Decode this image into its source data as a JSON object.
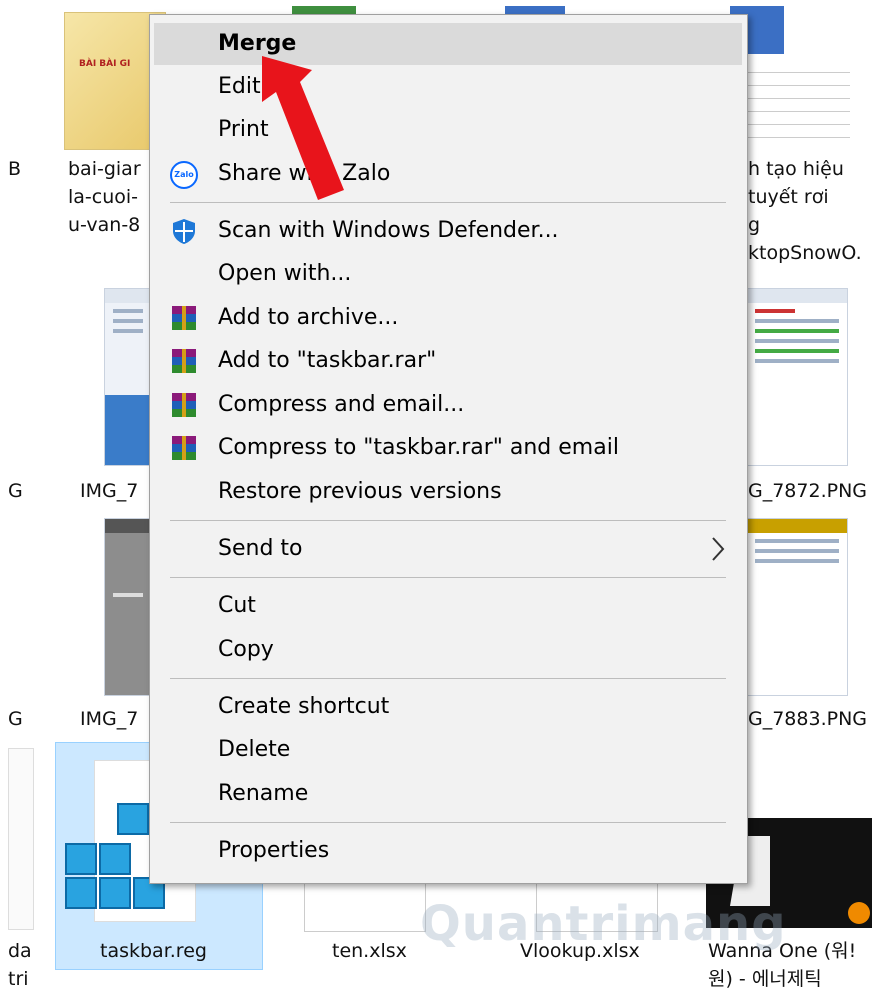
{
  "context_menu": {
    "items": [
      {
        "label": "Merge",
        "highlighted": true
      },
      {
        "label": "Edit"
      },
      {
        "label": "Print"
      },
      {
        "label": "Share with Zalo",
        "icon": "zalo-icon"
      },
      {
        "label": "Scan with Windows Defender...",
        "icon": "windows-defender-icon"
      },
      {
        "label": "Open with..."
      },
      {
        "label": "Add to archive...",
        "icon": "winrar-icon"
      },
      {
        "label": "Add to \"taskbar.rar\"",
        "icon": "winrar-icon"
      },
      {
        "label": "Compress and email...",
        "icon": "winrar-icon"
      },
      {
        "label": "Compress to \"taskbar.rar\" and email",
        "icon": "winrar-icon"
      },
      {
        "label": "Restore previous versions"
      },
      {
        "label": "Send to",
        "submenu": true
      },
      {
        "label": "Cut"
      },
      {
        "label": "Copy"
      },
      {
        "label": "Create shortcut"
      },
      {
        "label": "Delete"
      },
      {
        "label": "Rename"
      },
      {
        "label": "Properties"
      }
    ],
    "zalo_icon_text": "Zalo"
  },
  "files": {
    "left_col": [
      "B",
      "G",
      "G"
    ],
    "bai_giang": [
      "bai-giar",
      "la-cuoi-",
      "u-van-8"
    ],
    "thumb_text": "BÀI BÀI GI",
    "img1": "IMG_7",
    "img2": "IMG_7",
    "right_top": [
      "h tạo hiệu",
      "tuyết rơi",
      "g",
      "ktopSnowO."
    ],
    "right_img1": "G_7872.PNG",
    "right_img2": "G_7883.PNG",
    "bottom_left": [
      "da",
      "tri"
    ],
    "taskbar": "taskbar.reg",
    "ten": "ten.xlsx",
    "vlookup": "Vlookup.xlsx",
    "wanna": [
      "Wanna One (워!",
      "원) - 에너제틱"
    ]
  },
  "watermark": "Quantrimang",
  "colors": {
    "menu_bg": "#f2f2f2",
    "highlight": "#dadada",
    "arrow": "#e8141b",
    "selection": "#cce8ff"
  }
}
